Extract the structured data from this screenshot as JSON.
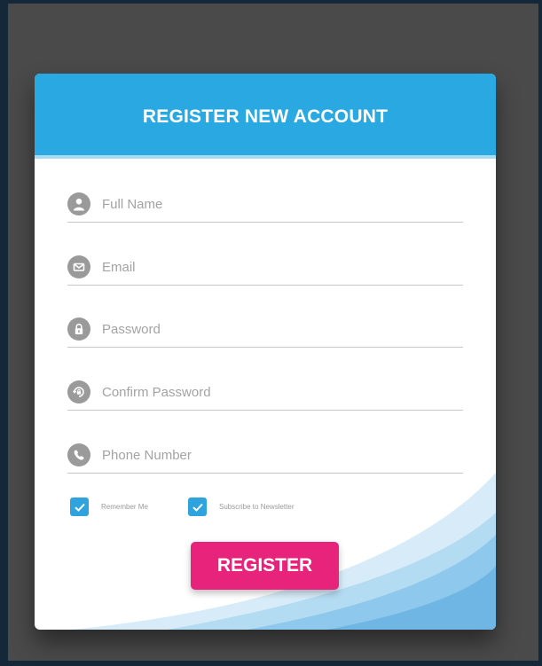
{
  "form": {
    "title": "REGISTER NEW ACCOUNT",
    "fields": [
      {
        "icon": "user-icon",
        "placeholder": "Full Name",
        "value": ""
      },
      {
        "icon": "envelope-icon",
        "placeholder": "Email",
        "value": ""
      },
      {
        "icon": "lock-icon",
        "placeholder": "Password",
        "value": ""
      },
      {
        "icon": "lock-confirm-icon",
        "placeholder": "Confirm Password",
        "value": ""
      },
      {
        "icon": "phone-icon",
        "placeholder": "Phone Number",
        "value": ""
      }
    ],
    "checkboxes": [
      {
        "label": "Remember Me",
        "checked": true
      },
      {
        "label": "Subscribe to Newsletter",
        "checked": true
      }
    ],
    "submit_label": "REGISTER"
  },
  "colors": {
    "accent": "#29a8e2",
    "button": "#e8237c",
    "background": "#4a4a4a"
  }
}
